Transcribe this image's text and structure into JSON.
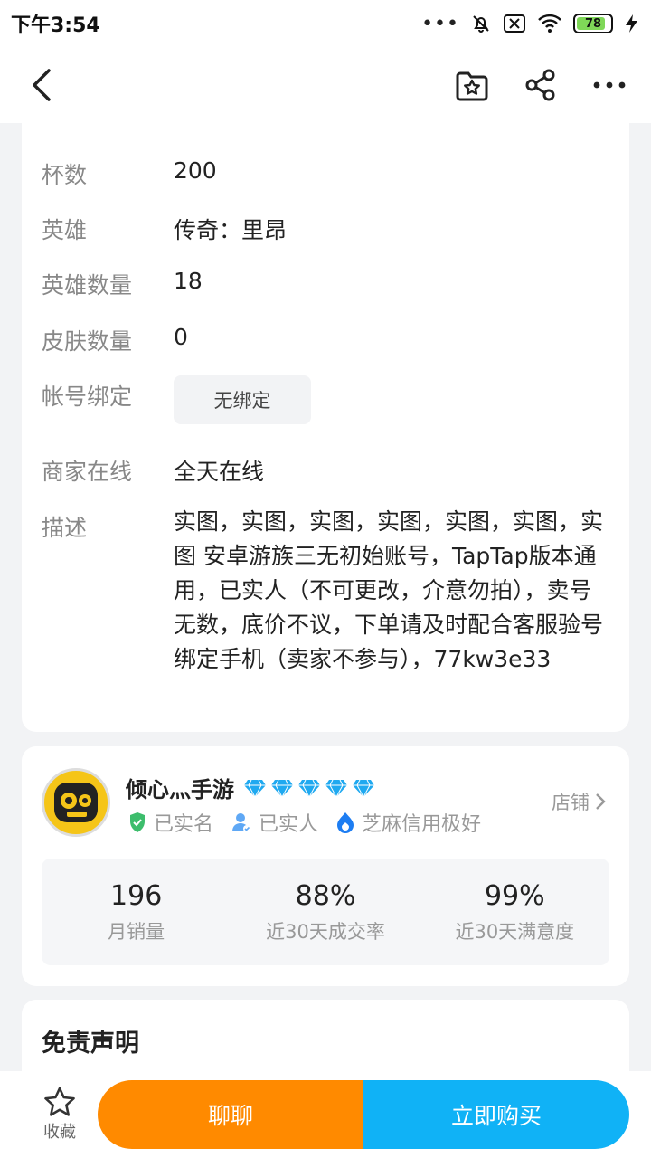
{
  "status_bar": {
    "time": "下午3:54",
    "battery": "78"
  },
  "details": {
    "rows": [
      {
        "label": "杯数",
        "value": "200"
      },
      {
        "label": "英雄",
        "value": "传奇：里昂"
      },
      {
        "label": "英雄数量",
        "value": "18"
      },
      {
        "label": "皮肤数量",
        "value": "0"
      },
      {
        "label": "帐号绑定",
        "value": "无绑定"
      },
      {
        "label": "商家在线",
        "value": "全天在线"
      },
      {
        "label": "描述",
        "value": "实图，实图，实图，实图，实图，实图，实图 安卓游族三无初始账号，TapTap版本通用，已实人（不可更改，介意勿拍），卖号无数，底价不议，下单请及时配合客服验号绑定手机（卖家不参与），77kw3e33"
      }
    ]
  },
  "seller": {
    "name": "倾心灬手游",
    "badges": [
      "已实名",
      "已实人",
      "芝麻信用极好"
    ],
    "shop_link": "店铺",
    "stats": [
      {
        "value": "196",
        "label": "月销量"
      },
      {
        "value": "88%",
        "label": "近30天成交率"
      },
      {
        "value": "99%",
        "label": "近30天满意度"
      }
    ]
  },
  "disclaimer": {
    "title": "免责声明"
  },
  "bottom_bar": {
    "fav_label": "收藏",
    "chat_label": "聊聊",
    "buy_label": "立即购买"
  },
  "colors": {
    "chat": "#ff8a00",
    "buy": "#10b2f6",
    "diamond": "#1fa9f0"
  }
}
